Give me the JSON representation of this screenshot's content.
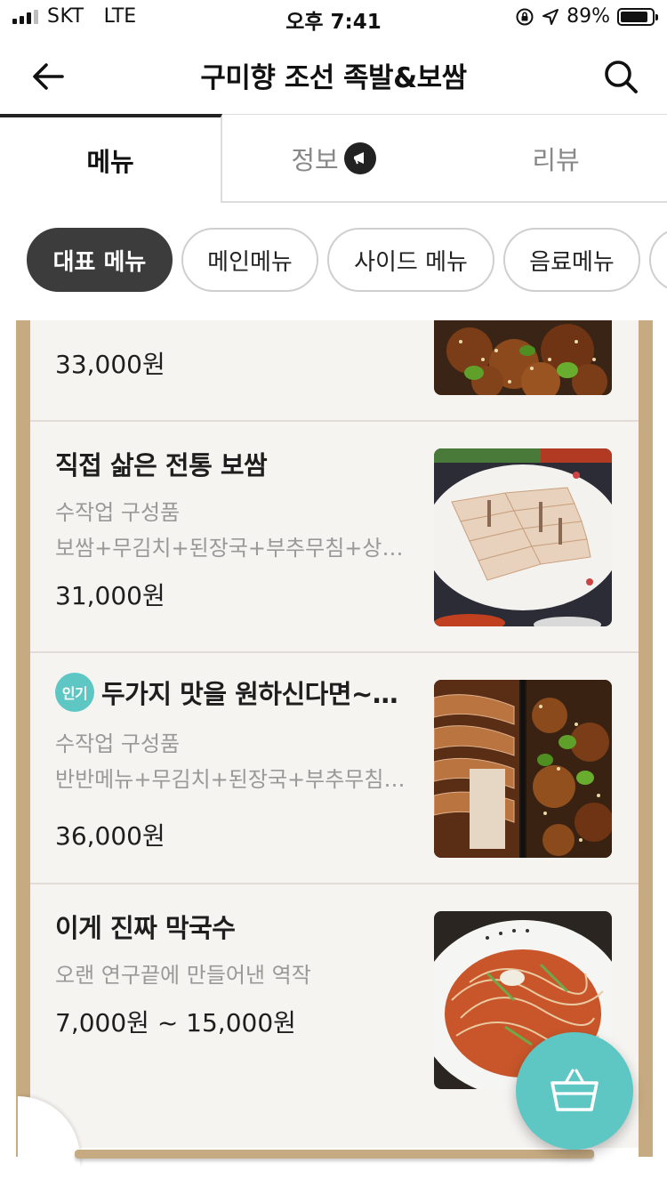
{
  "status": {
    "carrier": "SKT",
    "network": "LTE",
    "time": "오후 7:41",
    "battery": "89%",
    "battery_level": 0.89
  },
  "header": {
    "title": "구미향 조선 족발&보쌈",
    "back_icon": "arrow-left-icon",
    "search_icon": "search-icon"
  },
  "tabs": [
    {
      "label": "메뉴",
      "active": true
    },
    {
      "label": "정보",
      "active": false,
      "icon": "megaphone-icon"
    },
    {
      "label": "리뷰",
      "active": false
    }
  ],
  "categories": [
    {
      "label": "대표 메뉴",
      "active": true
    },
    {
      "label": "메인메뉴",
      "active": false
    },
    {
      "label": "사이드 메뉴",
      "active": false
    },
    {
      "label": "음료메뉴",
      "active": false
    }
  ],
  "menu": [
    {
      "name": "",
      "desc1": "",
      "desc2": "",
      "price": "33,000원"
    },
    {
      "name": "직접 삶은 전통 보쌈",
      "desc1": "수작업 구성품",
      "desc2": "보쌈+무김치+된장국+부추무침+상…",
      "price": "31,000원"
    },
    {
      "name": "두가지 맛을 원하신다면~…",
      "badge": "인기",
      "desc1": "수작업 구성품",
      "desc2": "반반메뉴+무김치+된장국+부추무침…",
      "price": "36,000원"
    },
    {
      "name": "이게 진짜 막국수",
      "desc1": "오랜 연구끝에 만들어낸 역작",
      "desc2": "",
      "price": "7,000원 ~ 15,000원"
    }
  ],
  "cart_icon": "basket-icon",
  "colors": {
    "accent": "#5ec7c4",
    "frame": "#c6ab82",
    "chip_active": "#3c3c3c"
  }
}
